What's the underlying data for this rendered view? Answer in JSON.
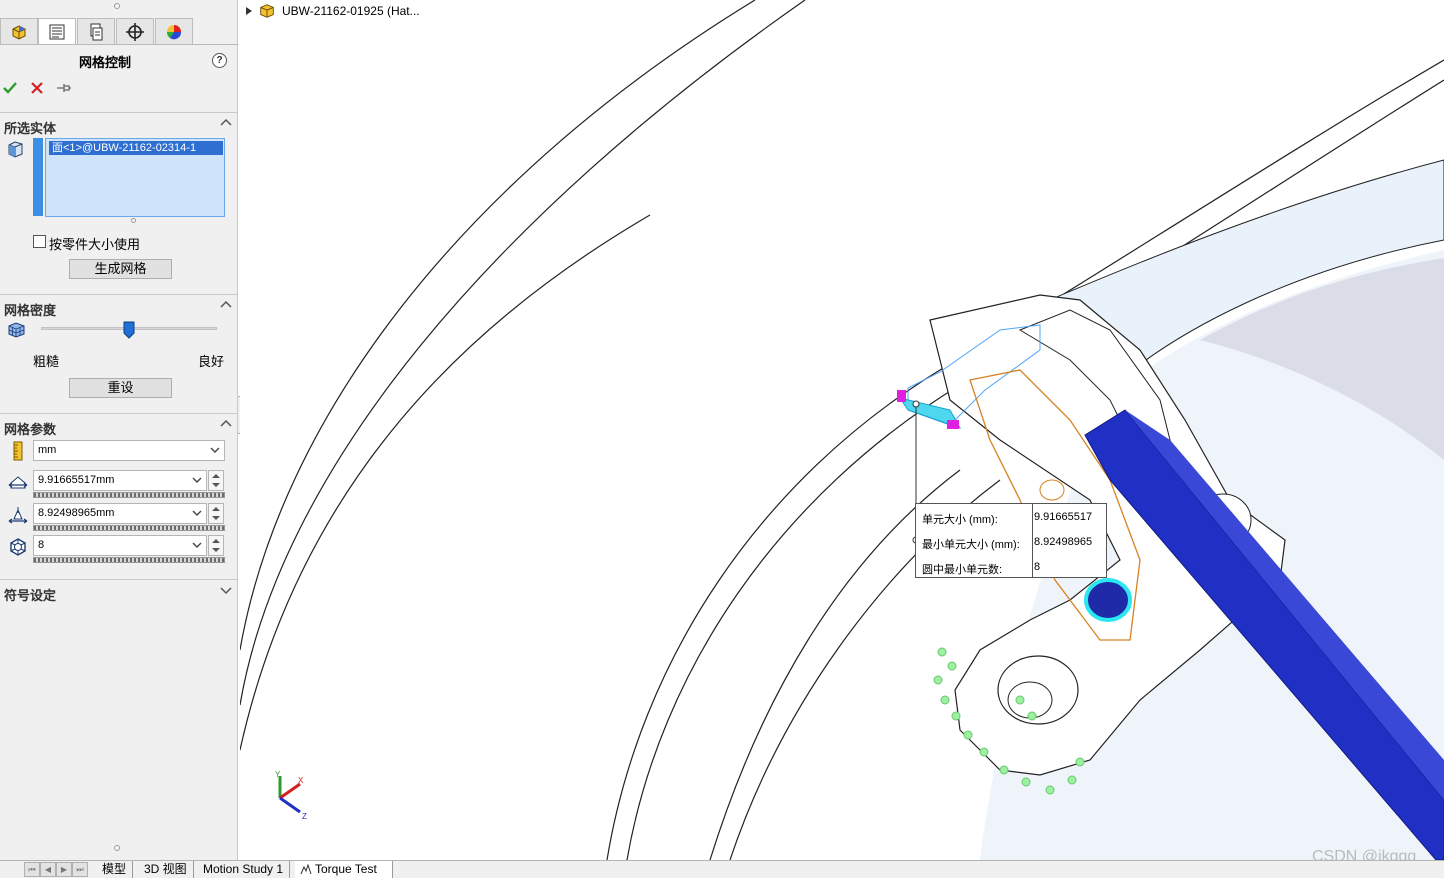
{
  "property_manager": {
    "title": "网格控制",
    "help": "?",
    "selected_entities": {
      "header": "所选实体",
      "items": [
        "面<1>@UBW-21162-02314-1"
      ]
    },
    "use_part_size_label": "按零件大小使用",
    "use_part_size_checked": false,
    "create_mesh_button": "生成网格",
    "mesh_density": {
      "header": "网格密度",
      "coarse_label": "粗糙",
      "fine_label": "良好",
      "slider_level_fraction": 0.5,
      "reset_button": "重设"
    },
    "mesh_parameters": {
      "header": "网格参数",
      "unit": "mm",
      "element_size": "9.91665517mm",
      "min_element_size": "8.92498965mm",
      "min_elements_in_circle": "8"
    },
    "symbol_settings": {
      "header": "符号设定"
    }
  },
  "viewport": {
    "tree_node_label": "UBW-21162-01925 (Hat...",
    "callout": {
      "rows": [
        {
          "key": "单元大小 (mm):",
          "value": "9.91665517"
        },
        {
          "key": "最小单元大小 (mm):",
          "value": "8.92498965"
        },
        {
          "key": "圆中最小单元数:",
          "value": "8"
        }
      ]
    },
    "triad": {
      "x": "X",
      "y": "Y",
      "z": "Z"
    },
    "watermark": "CSDN @jkggg"
  },
  "bottom_tabs": [
    {
      "label": "模型",
      "active": false
    },
    {
      "label": "3D 视图",
      "active": false
    },
    {
      "label": "Motion Study 1",
      "active": false
    },
    {
      "label": "Torque Test",
      "active": true
    }
  ],
  "colors": {
    "accent_blue": "#2f6fd1",
    "selection_bg": "#cfe3fb",
    "confirm_green": "#2e9b2e",
    "cancel_red": "#d42020",
    "part_blue": "#1f2fbf",
    "highlight_cyan": "#4fd7f0",
    "magenta": "#e020e0"
  }
}
